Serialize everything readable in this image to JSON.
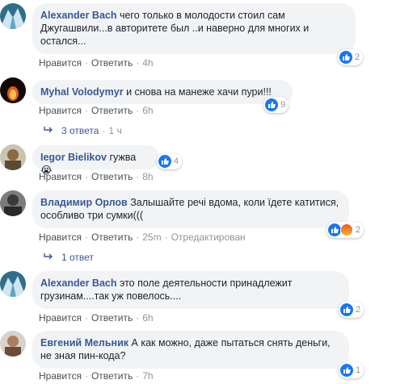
{
  "comments": [
    {
      "author": "Alexander Bach",
      "text": "чего только в молодости стоил сам Джугашвили...в авторитете был ..и наверно для многих и остался...",
      "like_label": "Нравится",
      "reply_label": "Ответить",
      "time": "4h",
      "reaction_count": "2"
    },
    {
      "author": "Myhal Volodymyr",
      "text": "и снова на манеже хачи пури!!!",
      "like_label": "Нравится",
      "reply_label": "Ответить",
      "time": "6h",
      "reaction_count": "9",
      "replies_label": "3 ответа",
      "replies_time": "1 ч"
    },
    {
      "author": "Iegor Bielikov",
      "text": "гужва 😭",
      "like_label": "Нравится",
      "reply_label": "Ответить",
      "time": "8h",
      "reaction_count": "4"
    },
    {
      "author": "Владимир Орлов",
      "text": "Залышайте речі вдома, коли їдете катитися, особливо три сумки(((",
      "like_label": "Нравится",
      "reply_label": "Ответить",
      "time": "25m",
      "edited_label": "Отредактирован",
      "reaction_count": "2",
      "replies_label": "1 ответ"
    },
    {
      "author": "Alexander Bach",
      "text": "это поле деятельности принадлежит грузинам....так уж повелось....",
      "like_label": "Нравится",
      "reply_label": "Ответить",
      "time": "6h",
      "reaction_count": "2"
    },
    {
      "author": "Евгений Мельник",
      "text": "А как можно, даже пытаться снять деньги, не зная пин-кода?",
      "like_label": "Нравится",
      "reply_label": "Ответить",
      "time": "7h",
      "reaction_count": "1"
    }
  ]
}
